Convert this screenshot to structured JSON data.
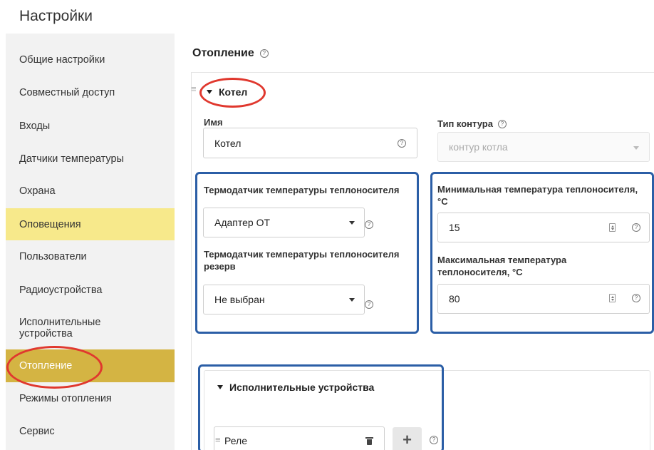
{
  "page": {
    "title": "Настройки"
  },
  "sidebar": {
    "items": [
      {
        "label": "Общие настройки"
      },
      {
        "label": "Совместный доступ"
      },
      {
        "label": "Входы"
      },
      {
        "label": "Датчики температуры"
      },
      {
        "label": "Охрана"
      },
      {
        "label": "Оповещения"
      },
      {
        "label": "Пользователи"
      },
      {
        "label": "Радиоустройства"
      },
      {
        "label": "Исполнительные устройства"
      },
      {
        "label": "Отопление"
      },
      {
        "label": "Режимы отопления"
      },
      {
        "label": "Сервис"
      }
    ],
    "active_index": 9,
    "highlighted_index": 5
  },
  "section": {
    "title": "Отопление",
    "help_icon": "question-circle-icon"
  },
  "boiler": {
    "header": "Котел",
    "name_label": "Имя",
    "name_value": "Котел",
    "circuit_type_label": "Тип контура",
    "circuit_type_value": "контур котла",
    "sensor_label": "Термодатчик температуры теплоносителя",
    "sensor_value": "Адаптер ОТ",
    "sensor_reserve_label": "Термодатчик температуры теплоносителя резерв",
    "sensor_reserve_value": "Не выбран",
    "min_temp_label": "Минимальная температура теплоносителя, °C",
    "min_temp_value": "15",
    "max_temp_label": "Максимальная температура теплоносителя, °C",
    "max_temp_value": "80"
  },
  "actuators": {
    "header": "Исполнительные устройства",
    "item_value": "Реле",
    "add_label": "+"
  },
  "colors": {
    "sidebar_bg": "#f2f2f2",
    "highlight_yellow": "#f7e98b",
    "active_gold": "#d4b443",
    "annotation_red": "#e0382e",
    "annotation_blue": "#2b5ea6"
  }
}
